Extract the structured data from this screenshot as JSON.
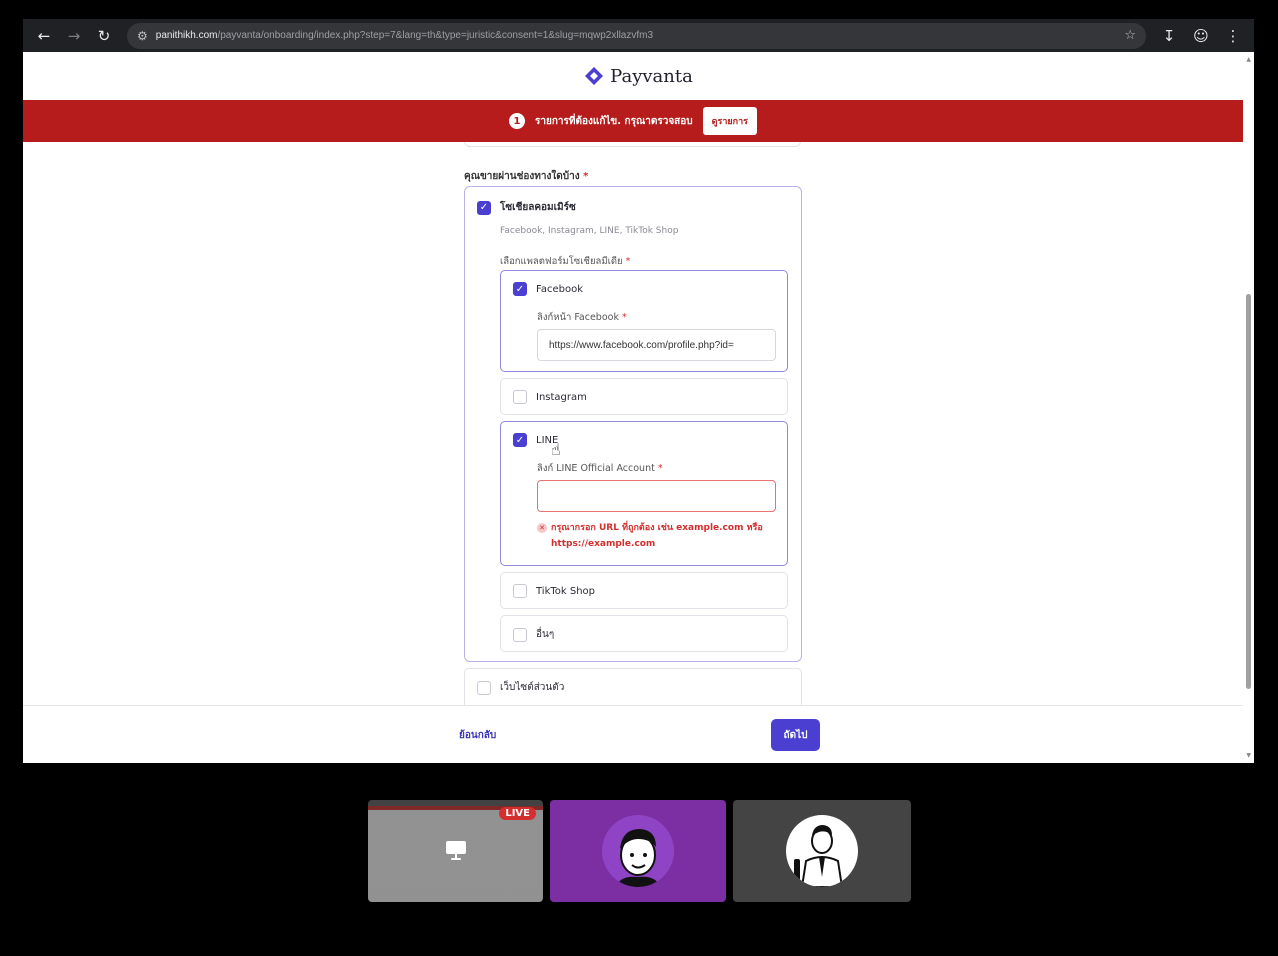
{
  "browser": {
    "url_host": "panithikh.com",
    "url_path": "/payvanta/onboarding/index.php?step=7&lang=th&type=juristic&consent=1&slug=mqwp2xllazvfm3"
  },
  "brand": {
    "name": "Payvanta"
  },
  "alert": {
    "count": "1",
    "message": "รายการที่ต้องแก้ไข. กรุณาตรวจสอบ",
    "button": "ดูรายการ"
  },
  "form": {
    "question": "คุณขายผ่านช่องทางใดบ้าง",
    "required_mark": "*",
    "social": {
      "label": "โซเชียลคอมเมิร์ซ",
      "hint": "Facebook, Instagram, LINE, TikTok Shop",
      "platform_label": "เลือกแพลตฟอร์มโซเชียลมีเดีย"
    },
    "options": {
      "facebook": {
        "label": "Facebook",
        "field_label": "ลิงก์หน้า Facebook",
        "value": "https://www.facebook.com/profile.php?id="
      },
      "instagram": {
        "label": "Instagram"
      },
      "line": {
        "label": "LINE",
        "field_label": "ลิงก์ LINE Official Account",
        "value": "",
        "error_line1": "กรุณากรอก URL ที่ถูกต้อง เช่น example.com หรือ",
        "error_line2": "https://example.com"
      },
      "tiktok": {
        "label": "TikTok Shop"
      },
      "other": {
        "label": "อื่นๆ"
      }
    },
    "website": {
      "label": "เว็บไซต์ส่วนตัว"
    }
  },
  "footer": {
    "back": "ย้อนกลับ",
    "next": "ถัดไป"
  },
  "participants": {
    "live_label": "LIVE"
  },
  "colors": {
    "accent": "#4a3fd0",
    "alert": "#b71c1c",
    "error": "#d32f2f"
  }
}
